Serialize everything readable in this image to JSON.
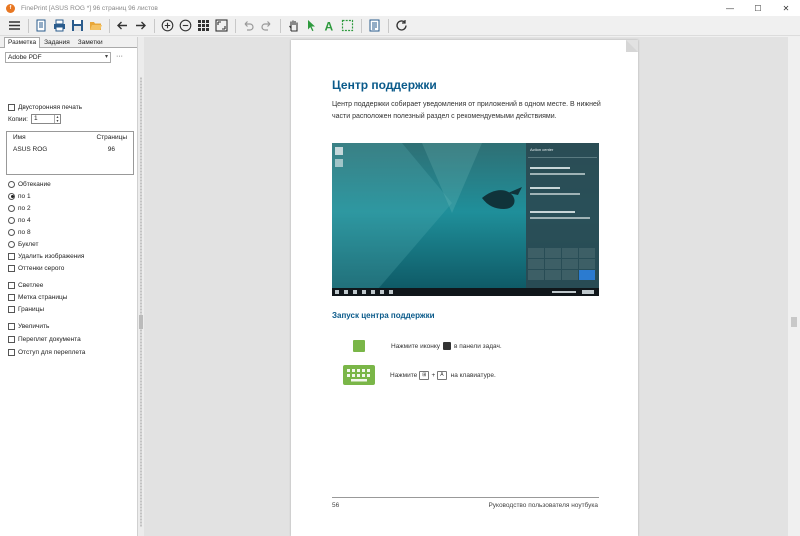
{
  "window": {
    "title": "FinePrint [ASUS ROG *] 96 страниц 96 листов",
    "controls": {
      "minimize": "—",
      "maximize": "☐",
      "close": "✕"
    }
  },
  "toolbar": {
    "icons": [
      "menu-icon",
      "printer-icon",
      "print-icon",
      "save-icon",
      "open-folder-icon",
      "arrow-left-icon",
      "arrow-right-icon",
      "zoom-in-icon",
      "zoom-out-icon",
      "grid-icon",
      "fit-icon",
      "undo-icon",
      "redo-icon",
      "hand-icon",
      "select-arrow-icon",
      "text-icon",
      "crop-icon",
      "page-view-icon",
      "refresh-icon"
    ]
  },
  "left_panel": {
    "tabs": [
      "Разметка",
      "Задания",
      "Заметки"
    ],
    "printer": "Adobe PDF",
    "more": "···",
    "duplex_label": "Двусторонняя печать",
    "copies_label": "Копии:",
    "copies_value": "1",
    "jobs": {
      "col_name": "Имя",
      "col_pages": "Страницы",
      "rows": [
        {
          "name": "ASUS ROG",
          "pages": "96"
        }
      ]
    },
    "layout_options": [
      {
        "label": "Обтекание",
        "selected": false
      },
      {
        "label": "по 1",
        "selected": true
      },
      {
        "label": "по 2",
        "selected": false
      },
      {
        "label": "по 4",
        "selected": false
      },
      {
        "label": "по 8",
        "selected": false
      },
      {
        "label": "Буклет",
        "selected": false
      }
    ],
    "checks_a": [
      "Удалить изображения",
      "Оттенки серого"
    ],
    "checks_b": [
      "Светлее",
      "Метка страницы",
      "Границы"
    ],
    "checks_c": [
      "Увеличить",
      "Переплет документа",
      "Отступ для переплета"
    ]
  },
  "page": {
    "heading": "Центр поддержки",
    "intro": "Центр поддержки собирает уведомления от приложений в одном месте. В нижней части расположен полезный раздел с рекомендуемыми действиями.",
    "subheading": "Запуск центра поддержки",
    "step1_a": "Нажмите иконку",
    "step1_b": "в панели задач.",
    "step2_a": "Нажмите",
    "step2_key1": "⊞",
    "step2_plus": "+",
    "step2_key2": "A",
    "step2_b": "на клавиатуре.",
    "page_number": "56",
    "footer_title": "Руководство пользователя ноутбука",
    "screenshot_panel_title": "Action center"
  },
  "colors": {
    "heading": "#0a5a8a",
    "accent_green": "#7ab648",
    "app_icon": "#e87722"
  }
}
